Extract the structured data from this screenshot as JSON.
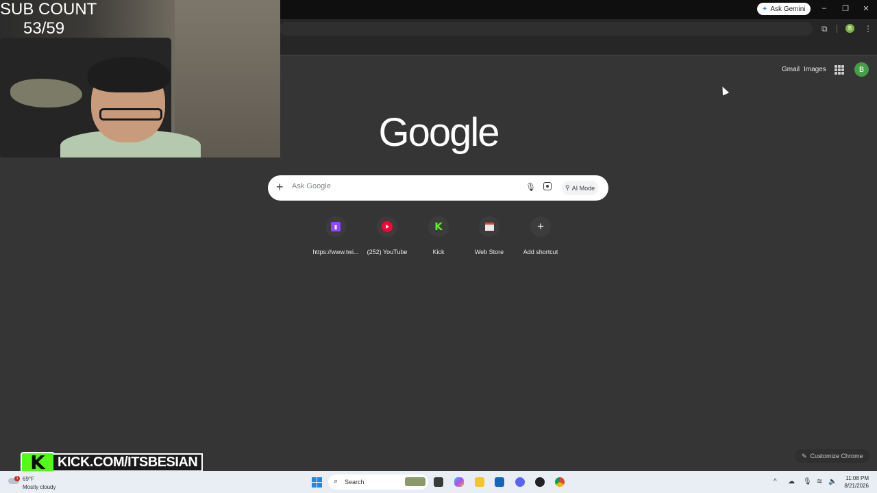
{
  "browser": {
    "ask_gemini_label": "Ask Gemini",
    "profile_initial": "B"
  },
  "ntp": {
    "gmail_label": "Gmail",
    "images_label": "Images",
    "avatar_initial": "B",
    "logo_text": "Google",
    "search": {
      "placeholder": "Ask Google",
      "ai_mode_label": "AI Mode"
    },
    "shortcuts": [
      {
        "label": "https://www.twi...",
        "icon": "twitch-icon"
      },
      {
        "label": "(252) YouTube",
        "icon": "youtube-icon"
      },
      {
        "label": "Kick",
        "icon": "kick-icon"
      },
      {
        "label": "Web Store",
        "icon": "web-store-icon"
      },
      {
        "label": "Add shortcut",
        "icon": "plus-icon"
      }
    ],
    "customize_label": "Customize Chrome"
  },
  "overlay": {
    "sub_count_label": "SUB COUNT",
    "sub_count_value": "53/59",
    "kick_banner_text": "KICK.COM/ITSBESIAN"
  },
  "taskbar": {
    "weather_temp": "69°F",
    "weather_desc": "Mostly cloudy",
    "weather_badge": "1",
    "search_label": "Search",
    "time": "11:08 PM",
    "date": "8/21/2026"
  }
}
